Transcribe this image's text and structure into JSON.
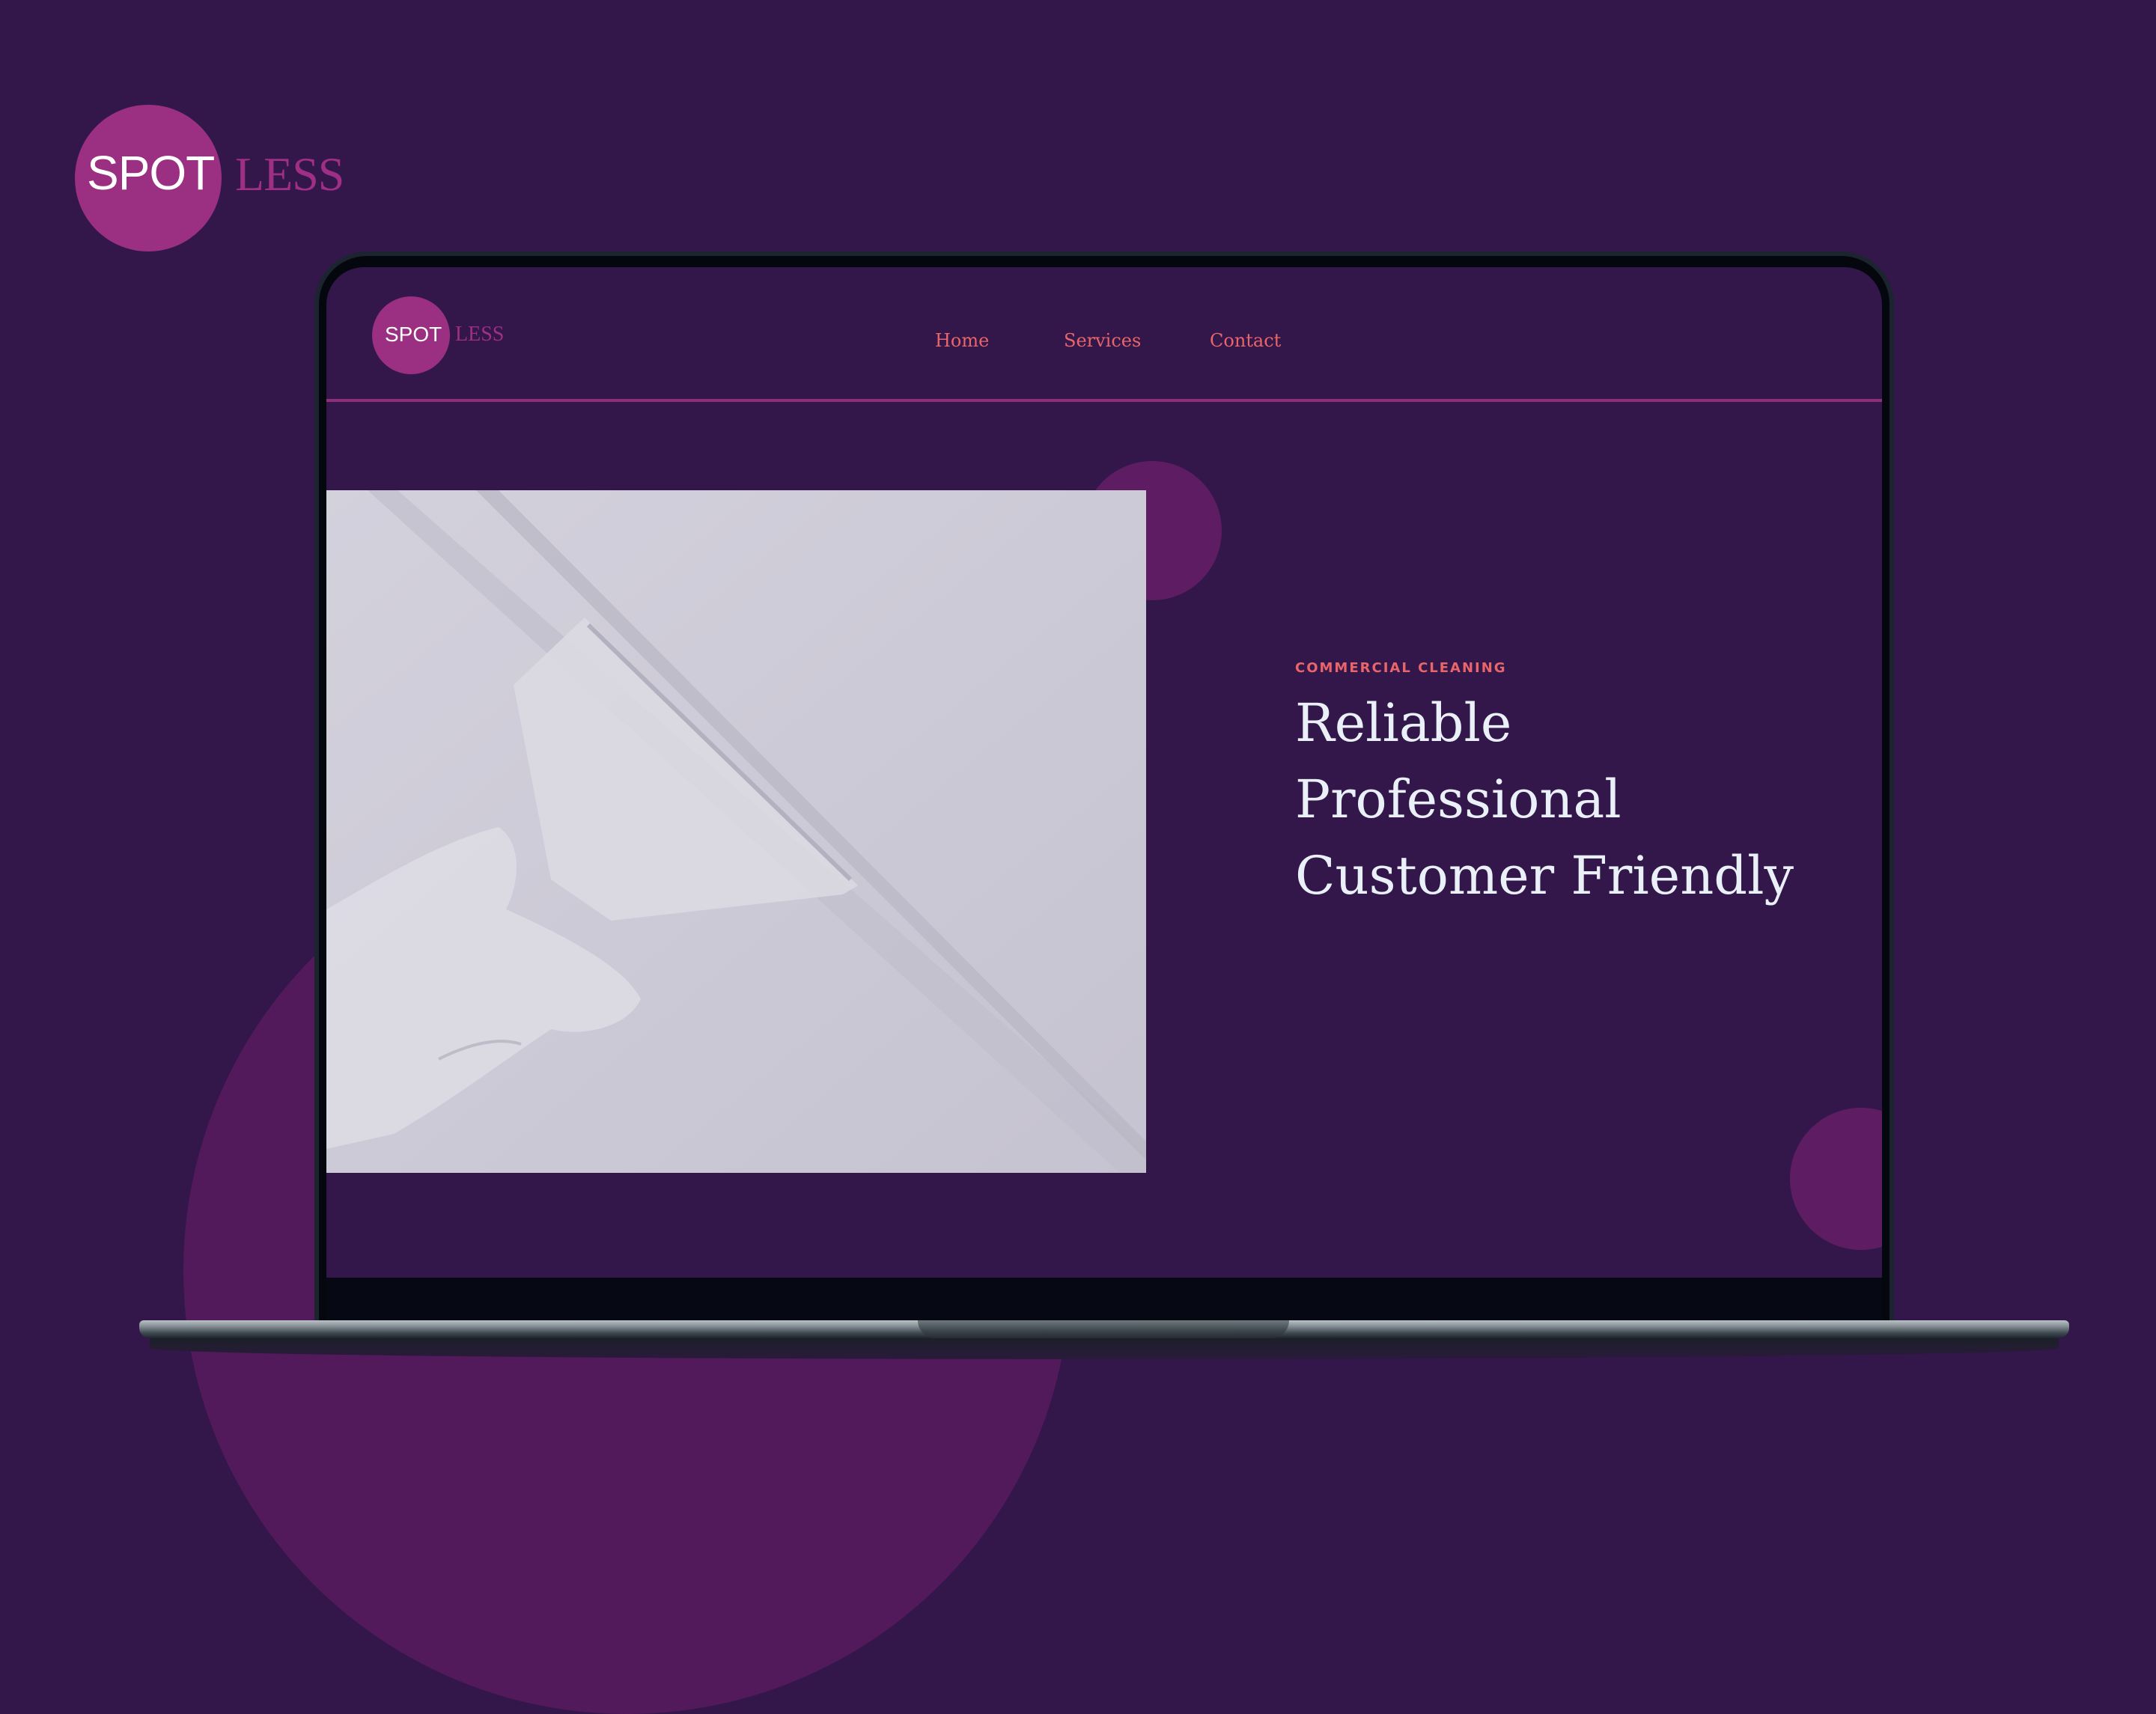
{
  "brand": {
    "spot": "SPOT",
    "less": "LESS"
  },
  "site": {
    "logo": {
      "spot": "SPOT",
      "less": "LESS"
    },
    "nav": [
      {
        "label": "Home"
      },
      {
        "label": "Services"
      },
      {
        "label": "Contact"
      }
    ],
    "hero": {
      "eyebrow": "COMMERCIAL CLEANING",
      "lines": [
        "Reliable",
        "Professional",
        "Customer Friendly"
      ]
    }
  },
  "colors": {
    "background": "#33174a",
    "brand_magenta": "#9b2f82",
    "accent_coral": "#e8656a",
    "heading_text": "#eaf0f8",
    "deco_purple": "#5e1d63"
  }
}
